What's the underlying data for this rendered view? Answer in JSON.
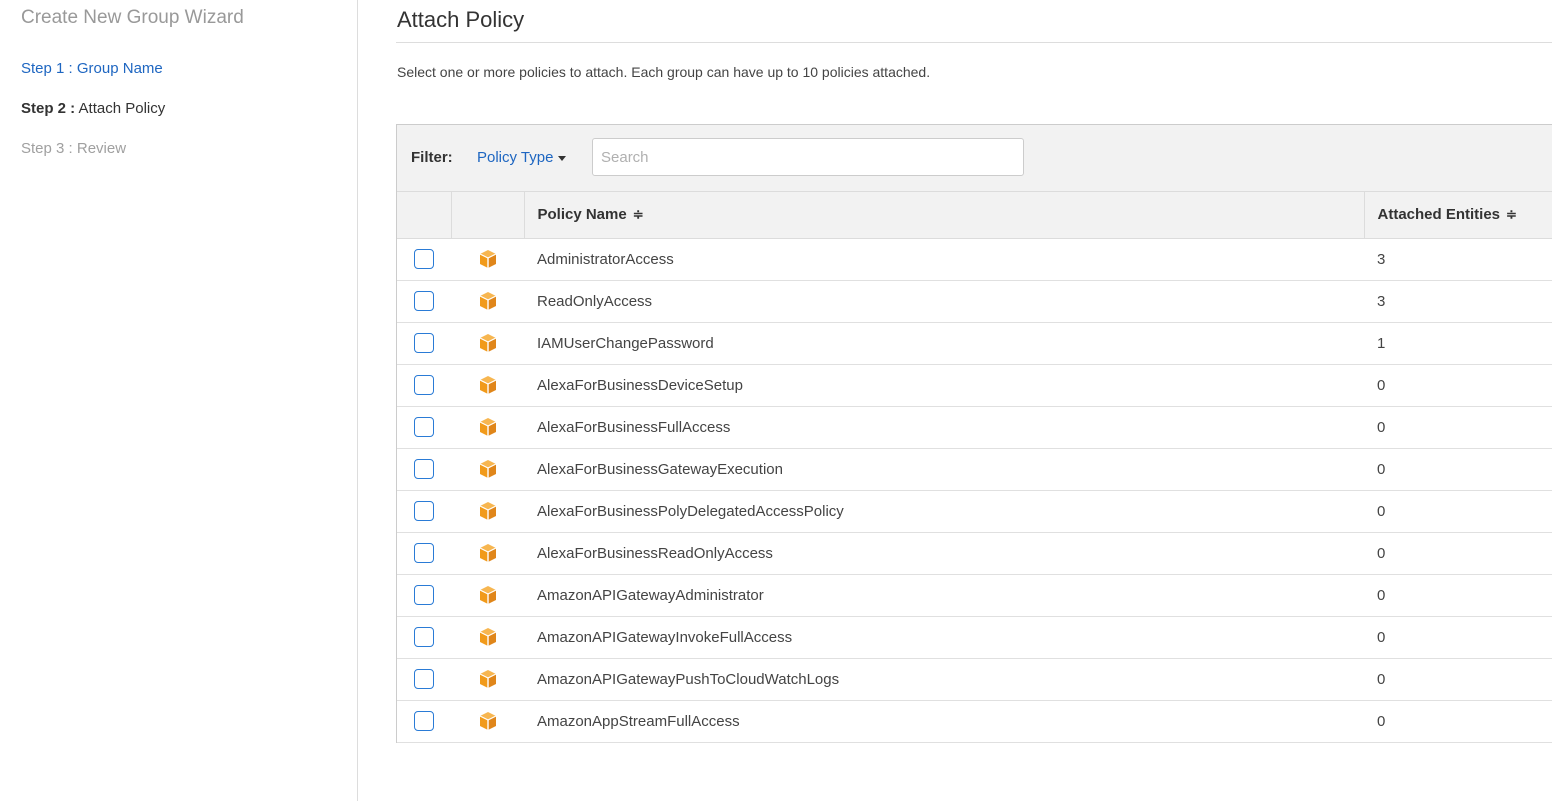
{
  "sidebar": {
    "title": "Create New Group Wizard",
    "steps": [
      {
        "prefix": "Step 1 :",
        "label": "Group Name"
      },
      {
        "prefix": "Step 2 :",
        "label": "Attach Policy"
      },
      {
        "prefix": "Step 3 :",
        "label": "Review"
      }
    ]
  },
  "main": {
    "title": "Attach Policy",
    "intro": "Select one or more policies to attach. Each group can have up to 10 policies attached."
  },
  "filter": {
    "label": "Filter:",
    "dropdown_label": "Policy Type",
    "search_placeholder": "Search",
    "search_value": ""
  },
  "table": {
    "columns": {
      "policy_name": "Policy Name",
      "attached_entities": "Attached Entities"
    },
    "sort_glyph": "≑",
    "rows": [
      {
        "name": "AdministratorAccess",
        "entities": "3"
      },
      {
        "name": "ReadOnlyAccess",
        "entities": "3"
      },
      {
        "name": "IAMUserChangePassword",
        "entities": "1"
      },
      {
        "name": "AlexaForBusinessDeviceSetup",
        "entities": "0"
      },
      {
        "name": "AlexaForBusinessFullAccess",
        "entities": "0"
      },
      {
        "name": "AlexaForBusinessGatewayExecution",
        "entities": "0"
      },
      {
        "name": "AlexaForBusinessPolyDelegatedAccessPolicy",
        "entities": "0"
      },
      {
        "name": "AlexaForBusinessReadOnlyAccess",
        "entities": "0"
      },
      {
        "name": "AmazonAPIGatewayAdministrator",
        "entities": "0"
      },
      {
        "name": "AmazonAPIGatewayInvokeFullAccess",
        "entities": "0"
      },
      {
        "name": "AmazonAPIGatewayPushToCloudWatchLogs",
        "entities": "0"
      },
      {
        "name": "AmazonAppStreamFullAccess",
        "entities": "0"
      }
    ]
  },
  "colors": {
    "link": "#1e66c1",
    "checkbox_border": "#2a7bd6",
    "policy_icon": "#f19a1a"
  },
  "icons": {
    "policy": "aws-managed-policy-cube-icon",
    "caret": "caret-down-icon",
    "sort": "sort-icon"
  }
}
